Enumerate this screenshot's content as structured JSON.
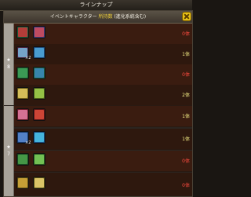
{
  "window": {
    "title": "ラインナップ"
  },
  "header": {
    "prefix": "イベントキャラクター",
    "count_label": "所持数",
    "suffix": "(進化系統含む)"
  },
  "groups": [
    {
      "rarity_star": "★",
      "rarity_value": "8",
      "rows": [
        {
          "owned": "0体",
          "owned_zero": true,
          "evo_badge": "",
          "icons": [
            "character-icon-red-green",
            "character-icon-red-blue"
          ]
        },
        {
          "owned": "1体",
          "owned_zero": false,
          "evo_badge": "×2",
          "icons": [
            "character-icon-blue-red",
            "character-icon-blue"
          ]
        },
        {
          "owned": "0体",
          "owned_zero": true,
          "evo_badge": "",
          "icons": [
            "character-icon-green",
            "character-icon-green-blue"
          ]
        },
        {
          "owned": "2体",
          "owned_zero": false,
          "evo_badge": "",
          "icons": [
            "character-icon-yellow",
            "character-icon-yellow-green"
          ]
        }
      ]
    },
    {
      "rarity_star": "★",
      "rarity_value": "7",
      "rows": [
        {
          "owned": "1体",
          "owned_zero": false,
          "evo_badge": "",
          "icons": [
            "character-icon-red-pink",
            "character-icon-red"
          ]
        },
        {
          "owned": "1体",
          "owned_zero": false,
          "evo_badge": "×2",
          "icons": [
            "character-icon-blue-dark",
            "character-icon-blue-light"
          ]
        },
        {
          "owned": "0体",
          "owned_zero": true,
          "evo_badge": "",
          "icons": [
            "character-icon-green-dark",
            "character-icon-green-light"
          ]
        },
        {
          "owned": "0体",
          "owned_zero": true,
          "evo_badge": "",
          "icons": [
            "character-icon-yellow-dark",
            "character-icon-yellow-light"
          ]
        }
      ]
    }
  ],
  "colors": {
    "owned_zero": "#ff4b3f",
    "owned_some": "#f6ef86",
    "count_highlight": "#f1d23a",
    "close_button": "#e8c218"
  }
}
